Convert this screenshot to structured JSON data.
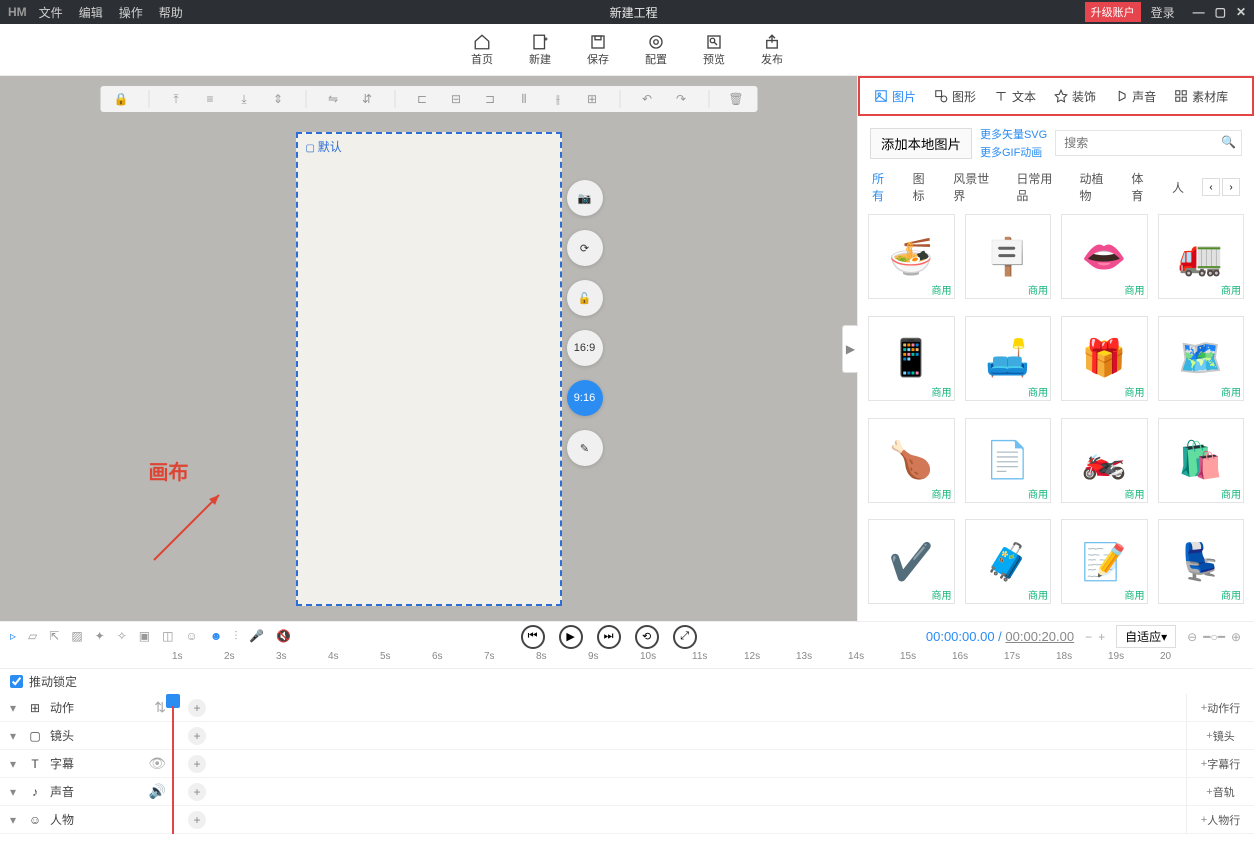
{
  "titlebar": {
    "brand": "HM",
    "menus": [
      "文件",
      "编辑",
      "操作",
      "帮助"
    ],
    "title": "新建工程",
    "upgrade": "升级账户",
    "login": "登录"
  },
  "maintoolbar": [
    {
      "label": "首页",
      "icon": "home"
    },
    {
      "label": "新建",
      "icon": "new"
    },
    {
      "label": "保存",
      "icon": "save"
    },
    {
      "label": "配置",
      "icon": "config"
    },
    {
      "label": "预览",
      "icon": "preview"
    },
    {
      "label": "发布",
      "icon": "publish"
    }
  ],
  "canvas": {
    "artboard_name": "默认",
    "annotation": "画布",
    "aspect_buttons": [
      "16:9",
      "9:16"
    ],
    "active_aspect": "9:16"
  },
  "sidepanel": {
    "tabs": [
      "图片",
      "图形",
      "文本",
      "装饰",
      "声音",
      "素材库"
    ],
    "active_tab": "图片",
    "add_button": "添加本地图片",
    "links": [
      "更多矢量SVG",
      "更多GIF动画"
    ],
    "search_placeholder": "搜索",
    "categories": [
      "所有",
      "图标",
      "风景世界",
      "日常用品",
      "动植物",
      "体育",
      "人"
    ],
    "active_category": "所有",
    "badge_text": "商用",
    "thumbs": [
      "🍜",
      "🪧",
      "👄",
      "🚛",
      "📱",
      "🛋️",
      "🎁",
      "🗺️",
      "🍗",
      "📄",
      "🏍️",
      "🛍️",
      "✔️",
      "🧳",
      "📝",
      "💺"
    ]
  },
  "playback": {
    "current": "00:00:00.00",
    "duration": "00:00:20.00",
    "fit": "自适应"
  },
  "timeline": {
    "lock_label": "推动锁定",
    "ruler": [
      "1s",
      "2s",
      "3s",
      "4s",
      "5s",
      "6s",
      "7s",
      "8s",
      "9s",
      "10s",
      "11s",
      "12s",
      "13s",
      "14s",
      "15s",
      "16s",
      "17s",
      "18s",
      "19s",
      "20"
    ],
    "tracks": [
      {
        "label": "动作",
        "add": "动作行",
        "extra": "sort"
      },
      {
        "label": "镜头",
        "add": "镜头"
      },
      {
        "label": "字幕",
        "add": "字幕行",
        "extra": "eye"
      },
      {
        "label": "声音",
        "add": "音轨",
        "extra": "speaker"
      },
      {
        "label": "人物",
        "add": "人物行"
      }
    ]
  }
}
